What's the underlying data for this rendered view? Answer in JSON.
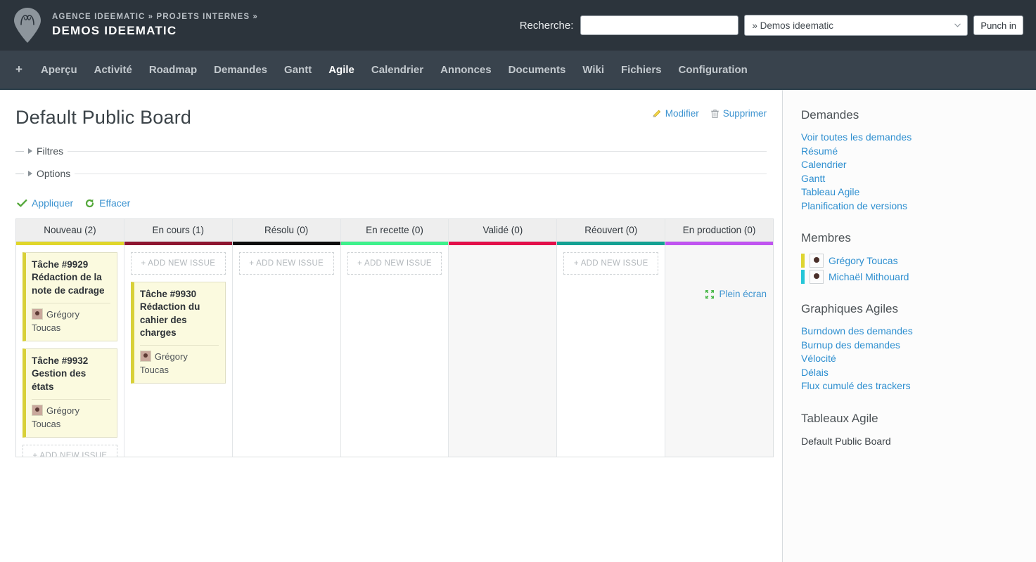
{
  "header": {
    "breadcrumb": "AGENCE IDEEMATIC » PROJETS INTERNES »",
    "project_title": "DEMOS IDEEMATIC",
    "logo_icon": "map-pin-logo-icon",
    "search_label": "Recherche:",
    "search_value": "",
    "project_select_value": "» Demos ideematic",
    "punch_label": "Punch in"
  },
  "nav": {
    "plus_label": "+",
    "items": [
      {
        "label": "Aperçu",
        "selected": false
      },
      {
        "label": "Activité",
        "selected": false
      },
      {
        "label": "Roadmap",
        "selected": false
      },
      {
        "label": "Demandes",
        "selected": false
      },
      {
        "label": "Gantt",
        "selected": false
      },
      {
        "label": "Agile",
        "selected": true
      },
      {
        "label": "Calendrier",
        "selected": false
      },
      {
        "label": "Annonces",
        "selected": false
      },
      {
        "label": "Documents",
        "selected": false
      },
      {
        "label": "Wiki",
        "selected": false
      },
      {
        "label": "Fichiers",
        "selected": false
      },
      {
        "label": "Configuration",
        "selected": false
      }
    ]
  },
  "content": {
    "page_title": "Default Public Board",
    "edit_label": "Modifier",
    "delete_label": "Supprimer",
    "filters_label": "Filtres",
    "options_label": "Options",
    "apply_label": "Appliquer",
    "clear_label": "Effacer",
    "fullscreen_label": "Plein écran",
    "add_issue_label": "+ ADD NEW ISSUE"
  },
  "board": {
    "columns": [
      {
        "title": "Nouveau (2)",
        "color": "#e0d62a",
        "disabled": false,
        "add_button_position": "bottom",
        "cards": [
          {
            "id": "Tâche #9929",
            "subject": "Rédaction de la note de cadrage",
            "assignee": "Grégory Toucas"
          },
          {
            "id": "Tâche #9932",
            "subject": "Gestion des états",
            "assignee": "Grégory Toucas"
          }
        ]
      },
      {
        "title": "En cours (1)",
        "color": "#8e1630",
        "disabled": false,
        "add_button_position": "top",
        "cards": [
          {
            "id": "Tâche #9930",
            "subject": "Rédaction du cahier des charges",
            "assignee": "Grégory Toucas"
          }
        ]
      },
      {
        "title": "Résolu (0)",
        "color": "#0d0d0d",
        "disabled": false,
        "add_button_position": "top",
        "cards": []
      },
      {
        "title": "En recette (0)",
        "color": "#3ef18c",
        "disabled": false,
        "add_button_position": "top",
        "cards": []
      },
      {
        "title": "Validé (0)",
        "color": "#e30f4a",
        "disabled": true,
        "add_button_position": "none",
        "cards": []
      },
      {
        "title": "Réouvert (0)",
        "color": "#14a193",
        "disabled": false,
        "add_button_position": "top",
        "cards": []
      },
      {
        "title": "En production (0)",
        "color": "#c054f0",
        "disabled": true,
        "add_button_position": "none",
        "cards": []
      }
    ]
  },
  "sidebar": {
    "groups": [
      {
        "heading": "Demandes",
        "type": "links",
        "links": [
          "Voir toutes les demandes",
          "Résumé",
          "Calendrier",
          "Gantt",
          "Tableau Agile",
          "Planification de versions"
        ]
      },
      {
        "heading": "Membres",
        "type": "members",
        "members": [
          {
            "name": "Grégory Toucas",
            "color": "#ded531"
          },
          {
            "name": "Michaël Mithouard",
            "color": "#26c6d8"
          }
        ]
      },
      {
        "heading": "Graphiques Agiles",
        "type": "links",
        "links": [
          "Burndown des demandes",
          "Burnup des demandes",
          "Vélocité",
          "Délais",
          "Flux cumulé des trackers"
        ]
      },
      {
        "heading": "Tableaux Agile",
        "type": "plain",
        "items": [
          "Default Public Board"
        ]
      }
    ]
  },
  "colors": {
    "header_bg": "#2c343c",
    "nav_bg": "#39434d",
    "link_blue": "#2e8fd0",
    "card_bg": "#fbfadf",
    "card_border_left": "#d8d038"
  }
}
